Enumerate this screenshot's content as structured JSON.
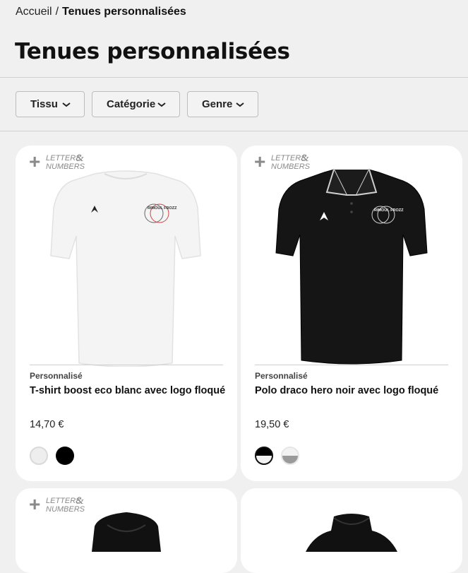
{
  "breadcrumb": {
    "home": "Accueil",
    "separator": "/",
    "current": "Tenues personnalisées"
  },
  "page": {
    "title": "Tenues personnalisées"
  },
  "filters": [
    {
      "label": "Tissu"
    },
    {
      "label": "Catégorie"
    },
    {
      "label": "Genre"
    }
  ],
  "badge": {
    "line1": "LETTERS",
    "line2": "NUMBERS",
    "amp": "&",
    "plus": "+"
  },
  "products": [
    {
      "tag": "Personnalisé",
      "name": "T-shirt boost eco blanc avec logo floqué",
      "price": "14,70 €",
      "garment": "t-shirt",
      "color": "#f4f4f4",
      "logo_text": "RIMOUL FROZZ",
      "swatches": [
        "white",
        "black"
      ]
    },
    {
      "tag": "Personnalisé",
      "name": "Polo draco hero noir avec logo floqué",
      "price": "19,50 €",
      "garment": "polo",
      "color": "#151515",
      "logo_text": "RIMOUL FROZZ",
      "swatches": [
        "black/white",
        "white/grey"
      ]
    },
    {
      "garment": "hoodie",
      "color": "#111111"
    },
    {
      "garment": "hoodie",
      "color": "#111111"
    }
  ],
  "colors": {
    "page_bg": "#f0f0f0",
    "card_bg": "#ffffff",
    "text": "#111111"
  }
}
